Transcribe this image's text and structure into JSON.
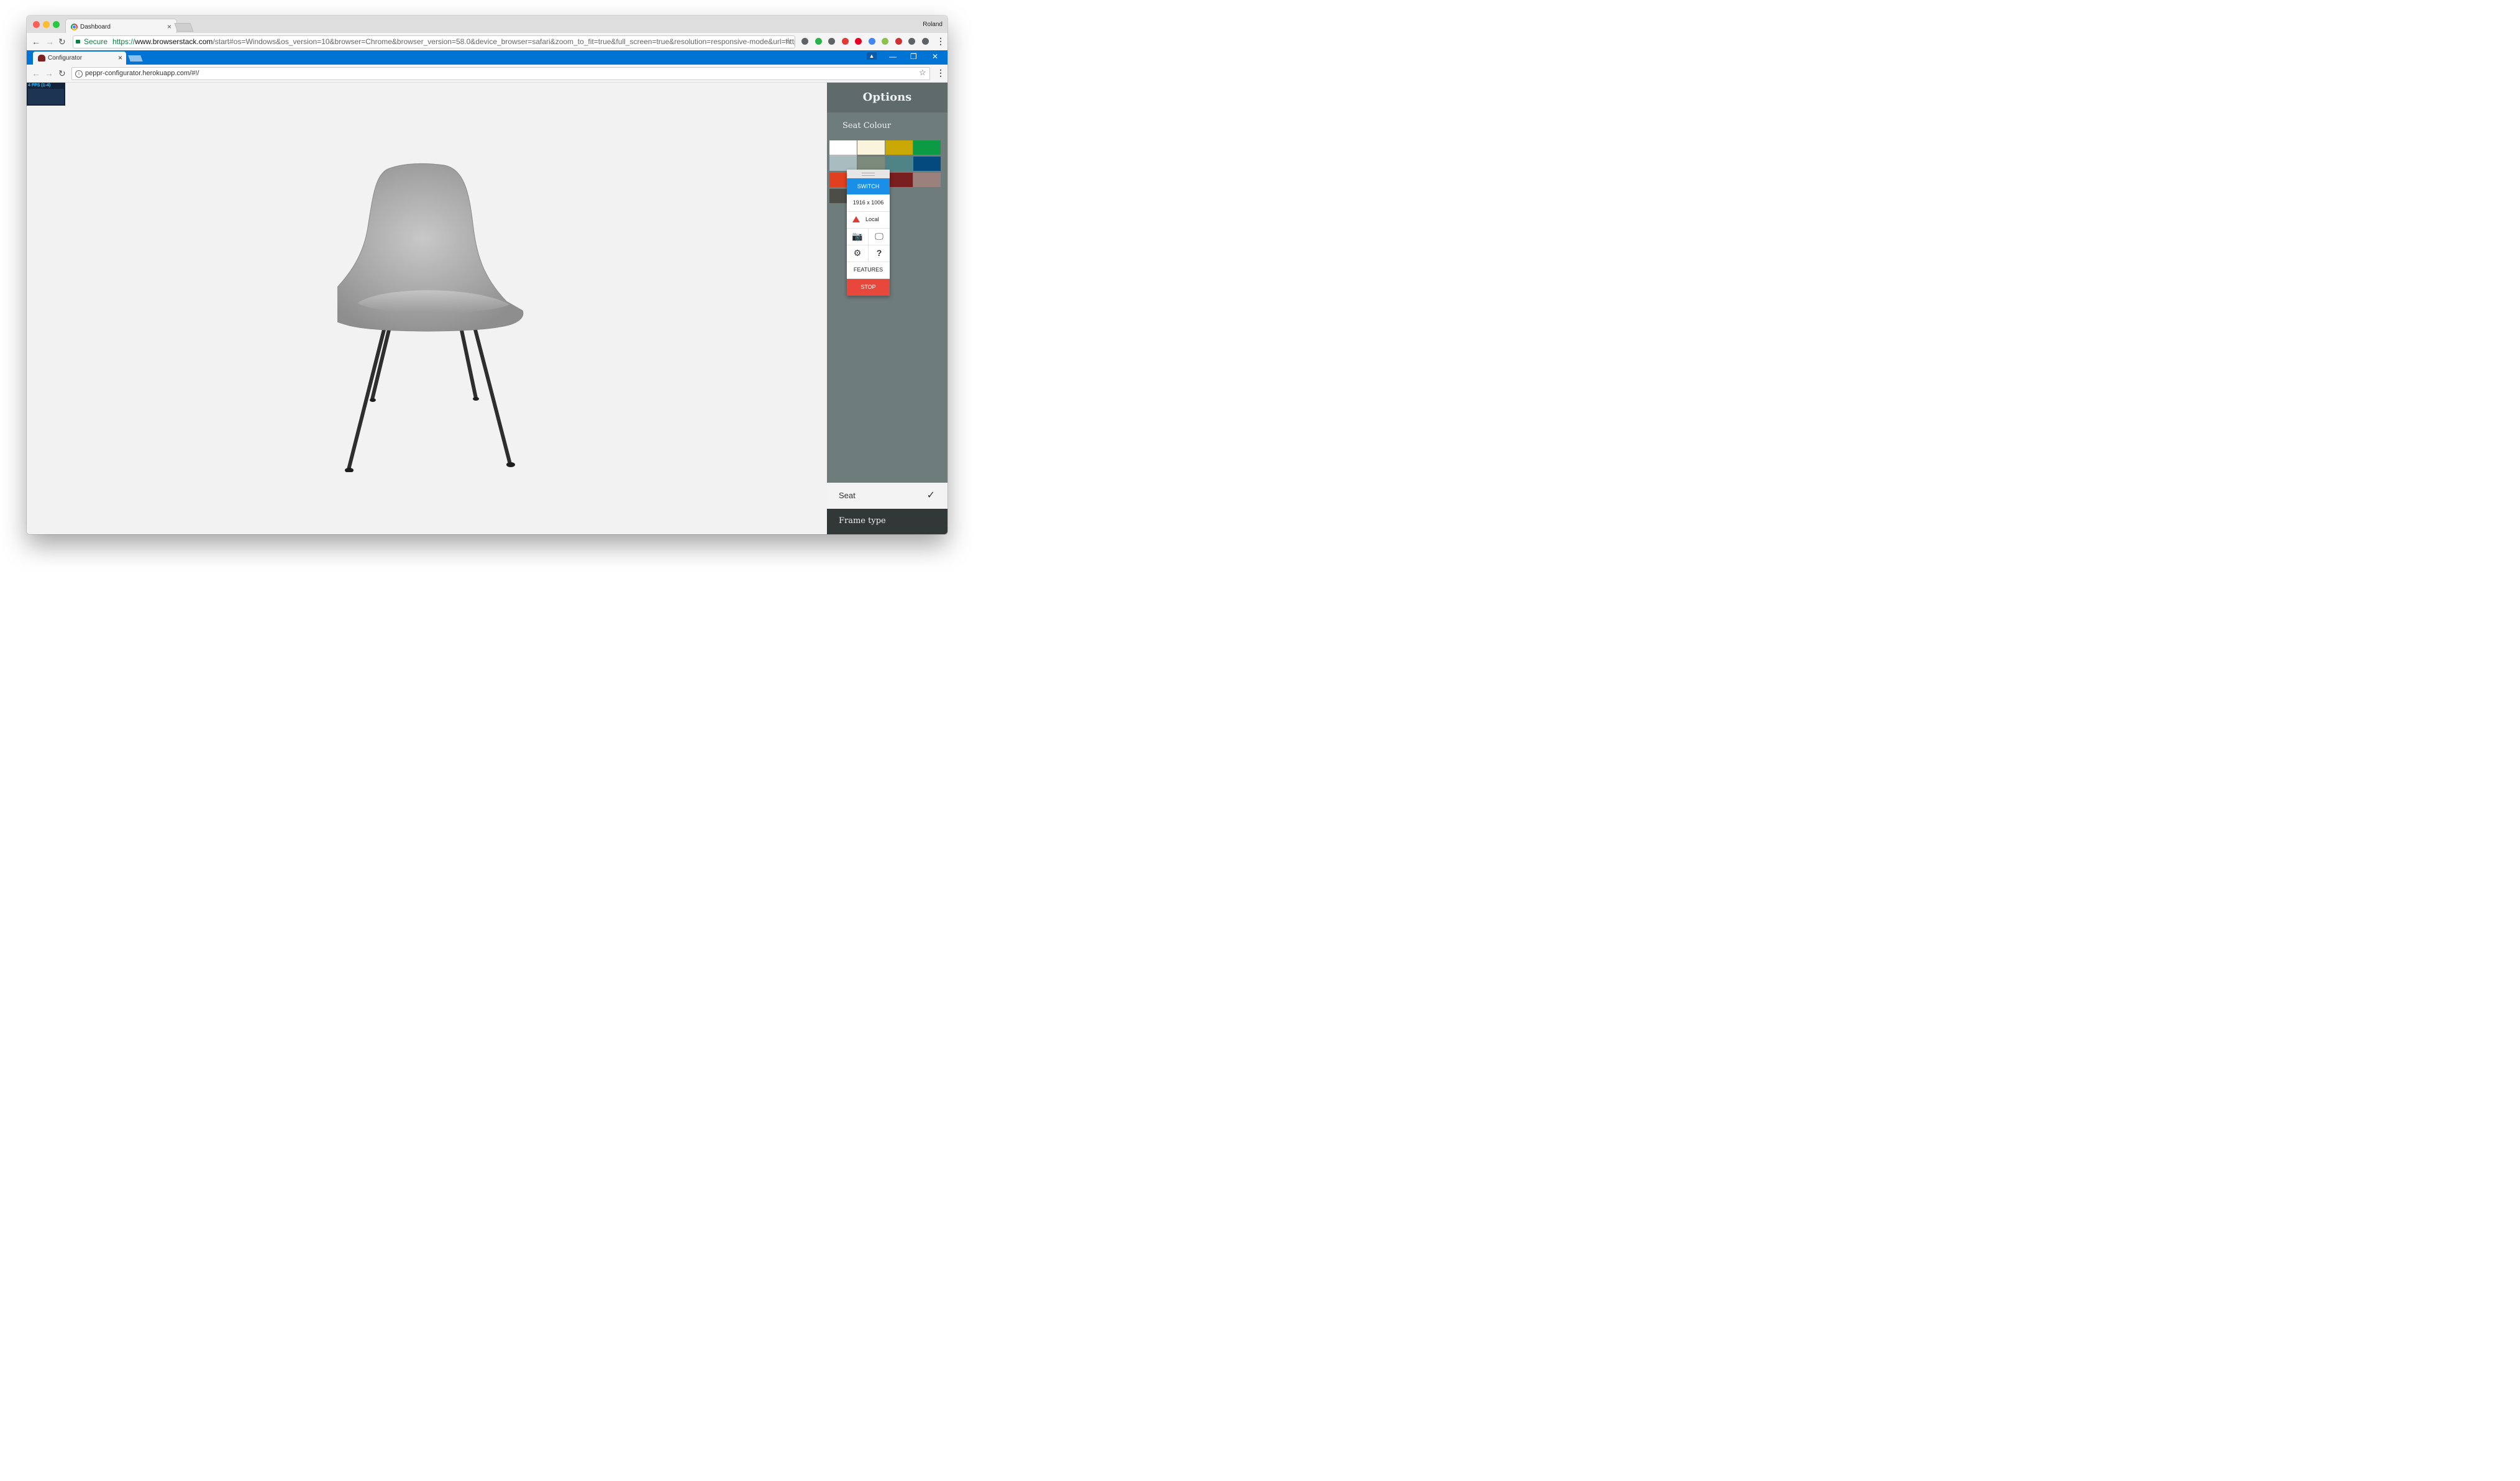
{
  "outer_browser": {
    "tab_title": "Dashboard",
    "tab_close": "×",
    "profile_name": "Roland",
    "secure_label": "Secure",
    "url_scheme": "https://",
    "url_host": "www.browserstack.com",
    "url_rest": "/start#os=Windows&os_version=10&browser=Chrome&browser_version=58.0&device_browser=safari&zoom_to_fit=true&full_screen=true&resolution=responsive-mode&url=http%3A...",
    "extensions": [
      {
        "icon": "pocket-icon",
        "color": "#5f6368"
      },
      {
        "icon": "feedly-icon",
        "color": "#2bb24c"
      },
      {
        "icon": "info-icon",
        "color": "#5f6368"
      },
      {
        "icon": "adblock-icon",
        "color": "#e53935"
      },
      {
        "icon": "pinterest-icon",
        "color": "#e60023"
      },
      {
        "icon": "ext-badge-icon",
        "color": "#4285f4"
      },
      {
        "icon": "tinyurl-icon",
        "color": "#8bc34a"
      },
      {
        "icon": "cors-icon",
        "color": "#d32f2f"
      },
      {
        "icon": "angular-icon",
        "color": "#5f6368"
      },
      {
        "icon": "incognito-icon",
        "color": "#5f6368"
      }
    ]
  },
  "inner_browser": {
    "tab_title": "Configurator",
    "tab_close": "×",
    "url": "peppr-configurator.herokuapp.com/#!/",
    "window_controls": [
      "—",
      "❐",
      "✕"
    ]
  },
  "fps_meter": "4 FPS (1-4)",
  "options_panel": {
    "title": "Options",
    "section_label": "Seat Colour",
    "swatches": [
      "#ffffff",
      "#fbf4dc",
      "#c9a806",
      "#0d9a44",
      "#a9bcbf",
      "#7b8a7b",
      "#4f8487",
      "#044a7e",
      "#e0401f",
      "#3d7a5e",
      "#7a1f1f",
      "#9a817c",
      "#4d4d47"
    ],
    "seat_row_label": "Seat",
    "seat_row_check": "✓",
    "frame_row_label": "Frame type"
  },
  "bs_toolbar": {
    "switch_label": "SWITCH",
    "resolution": "1916 x 1006",
    "local_label": "Local",
    "camera_icon": "📷",
    "devices_icon": "🖵",
    "settings_icon": "⚙",
    "help_icon": "?",
    "features_label": "FEATURES",
    "stop_label": "STOP"
  }
}
